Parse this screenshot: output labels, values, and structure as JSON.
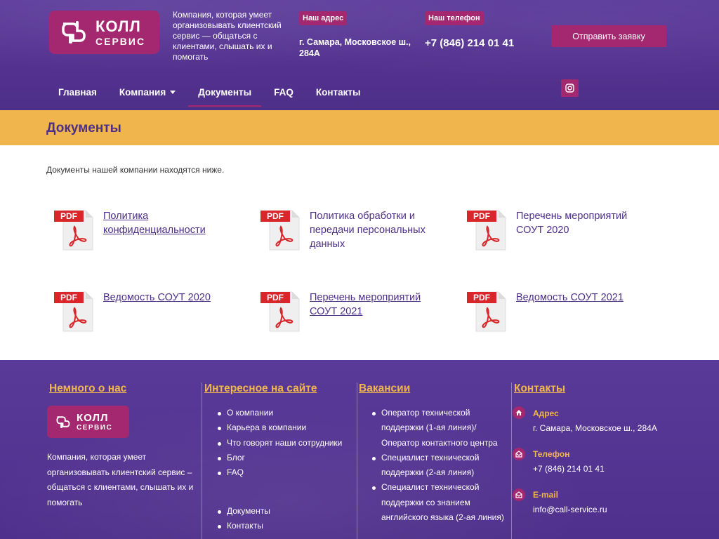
{
  "header": {
    "logo": {
      "line1": "КОЛЛ",
      "line2": "СЕРВИС"
    },
    "tagline": "Компания, которая умеет организовывать клиентский сервис — общаться с клиентами, слышать их и помогать",
    "address_label": "Наш адрес",
    "address_value": "г. Самара, Московское ш., 284А",
    "phone_label": "Наш телефон",
    "phone_value": "+7 (846) 214 01 41",
    "cta_label": "Отправить заявку",
    "instagram_icon": "instagram-icon"
  },
  "nav": {
    "items": [
      {
        "label": "Главная"
      },
      {
        "label": "Компания"
      },
      {
        "label": "Документы"
      },
      {
        "label": "FAQ"
      },
      {
        "label": "Контакты"
      }
    ],
    "active": "Документы"
  },
  "page": {
    "title": "Документы",
    "intro": "Документы нашей компании находятся ниже."
  },
  "documents": [
    {
      "label": "Политика конфиденциальности",
      "icon": "pdf-icon"
    },
    {
      "label": "Политика обработки и передачи персональных данных",
      "icon": "pdf-icon"
    },
    {
      "label": "Перечень мероприятий СОУТ 2020",
      "icon": "pdf-icon"
    },
    {
      "label": "Ведомость СОУТ 2020",
      "icon": "pdf-icon"
    },
    {
      "label": "Перечень мероприятий СОУТ 2021",
      "icon": "pdf-icon"
    },
    {
      "label": "Ведомость СОУТ 2021",
      "icon": "pdf-icon"
    }
  ],
  "footer": {
    "about": {
      "heading": "Немного о нас",
      "text": "Компания, которая умеет организовывать клиентский сервис – общаться с клиентами, слышать их и помогать"
    },
    "interesting": {
      "heading": "Интересное на сайте",
      "links": [
        "О компании",
        "Карьера в компании",
        "Что говорят наши сотрудники",
        "Блог",
        "FAQ"
      ],
      "links2": [
        "Документы",
        "Контакты"
      ]
    },
    "vacancies": {
      "heading": "Вакансии",
      "items": [
        "Оператор технической поддержки (1-ая линия)/ Оператор контактного центра",
        "Специалист технической поддержки (2-ая линия)",
        "Специалист технической поддержки со знанием английского языка (2-ая линия)"
      ]
    },
    "contacts": {
      "heading": "Контакты",
      "address_label": "Адрес",
      "address_value": "г. Самара, Московское ш., 284А",
      "phone_label": "Телефон",
      "phone_value": "+7 (846) 214 01 41",
      "email_label": "E-mail",
      "email_value": "info@call-service.ru"
    }
  },
  "colors": {
    "brand_purple": "#53328f",
    "accent_magenta": "#a3286f",
    "accent_yellow": "#f0b54d",
    "pdf_red": "#d9262a"
  }
}
